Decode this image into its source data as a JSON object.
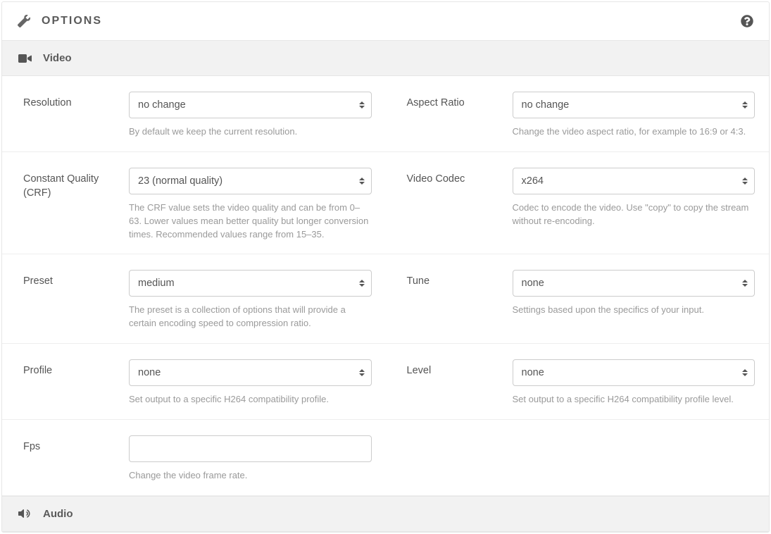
{
  "header": {
    "title": "OPTIONS"
  },
  "sections": {
    "video": {
      "title": "Video"
    },
    "audio": {
      "title": "Audio"
    }
  },
  "fields": {
    "resolution": {
      "label": "Resolution",
      "value": "no change",
      "help": "By default we keep the current resolution."
    },
    "aspect_ratio": {
      "label": "Aspect Ratio",
      "value": "no change",
      "help": "Change the video aspect ratio, for example to 16:9 or 4:3."
    },
    "crf": {
      "label": "Constant Quality (CRF)",
      "value": "23 (normal quality)",
      "help": "The CRF value sets the video quality and can be from 0–63. Lower values mean better quality but longer conversion times. Recommended values range from 15–35."
    },
    "video_codec": {
      "label": "Video Codec",
      "value": "x264",
      "help": "Codec to encode the video. Use \"copy\" to copy the stream without re-encoding."
    },
    "preset": {
      "label": "Preset",
      "value": "medium",
      "help": "The preset is a collection of options that will provide a certain encoding speed to compression ratio."
    },
    "tune": {
      "label": "Tune",
      "value": "none",
      "help": "Settings based upon the specifics of your input."
    },
    "profile": {
      "label": "Profile",
      "value": "none",
      "help": "Set output to a specific H264 compatibility profile."
    },
    "level": {
      "label": "Level",
      "value": "none",
      "help": "Set output to a specific H264 compatibility profile level."
    },
    "fps": {
      "label": "Fps",
      "value": "",
      "help": "Change the video frame rate."
    }
  }
}
